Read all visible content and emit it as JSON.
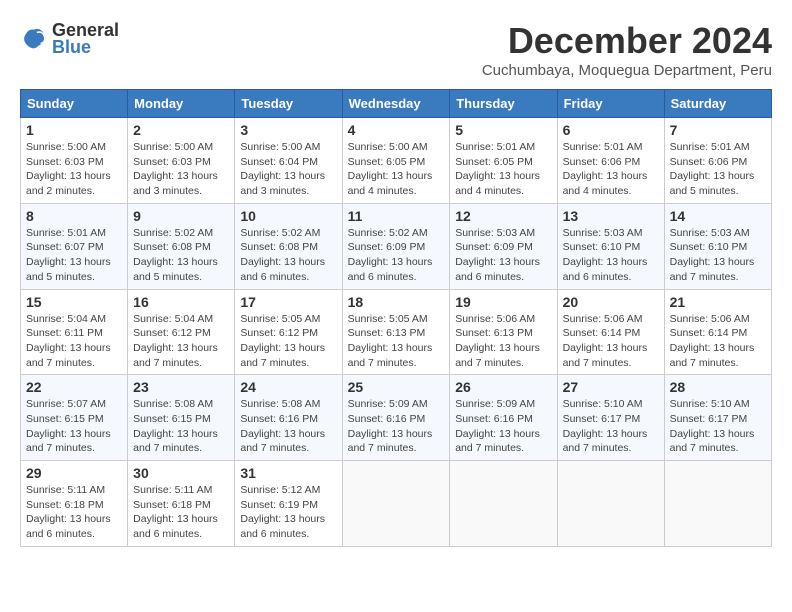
{
  "logo": {
    "general": "General",
    "blue": "Blue"
  },
  "title": "December 2024",
  "subtitle": "Cuchumbaya, Moquegua Department, Peru",
  "weekdays": [
    "Sunday",
    "Monday",
    "Tuesday",
    "Wednesday",
    "Thursday",
    "Friday",
    "Saturday"
  ],
  "weeks": [
    [
      {
        "day": "1",
        "sunrise": "5:00 AM",
        "sunset": "6:03 PM",
        "daylight": "13 hours and 2 minutes."
      },
      {
        "day": "2",
        "sunrise": "5:00 AM",
        "sunset": "6:03 PM",
        "daylight": "13 hours and 3 minutes."
      },
      {
        "day": "3",
        "sunrise": "5:00 AM",
        "sunset": "6:04 PM",
        "daylight": "13 hours and 3 minutes."
      },
      {
        "day": "4",
        "sunrise": "5:00 AM",
        "sunset": "6:05 PM",
        "daylight": "13 hours and 4 minutes."
      },
      {
        "day": "5",
        "sunrise": "5:01 AM",
        "sunset": "6:05 PM",
        "daylight": "13 hours and 4 minutes."
      },
      {
        "day": "6",
        "sunrise": "5:01 AM",
        "sunset": "6:06 PM",
        "daylight": "13 hours and 4 minutes."
      },
      {
        "day": "7",
        "sunrise": "5:01 AM",
        "sunset": "6:06 PM",
        "daylight": "13 hours and 5 minutes."
      }
    ],
    [
      {
        "day": "8",
        "sunrise": "5:01 AM",
        "sunset": "6:07 PM",
        "daylight": "13 hours and 5 minutes."
      },
      {
        "day": "9",
        "sunrise": "5:02 AM",
        "sunset": "6:08 PM",
        "daylight": "13 hours and 5 minutes."
      },
      {
        "day": "10",
        "sunrise": "5:02 AM",
        "sunset": "6:08 PM",
        "daylight": "13 hours and 6 minutes."
      },
      {
        "day": "11",
        "sunrise": "5:02 AM",
        "sunset": "6:09 PM",
        "daylight": "13 hours and 6 minutes."
      },
      {
        "day": "12",
        "sunrise": "5:03 AM",
        "sunset": "6:09 PM",
        "daylight": "13 hours and 6 minutes."
      },
      {
        "day": "13",
        "sunrise": "5:03 AM",
        "sunset": "6:10 PM",
        "daylight": "13 hours and 6 minutes."
      },
      {
        "day": "14",
        "sunrise": "5:03 AM",
        "sunset": "6:10 PM",
        "daylight": "13 hours and 7 minutes."
      }
    ],
    [
      {
        "day": "15",
        "sunrise": "5:04 AM",
        "sunset": "6:11 PM",
        "daylight": "13 hours and 7 minutes."
      },
      {
        "day": "16",
        "sunrise": "5:04 AM",
        "sunset": "6:12 PM",
        "daylight": "13 hours and 7 minutes."
      },
      {
        "day": "17",
        "sunrise": "5:05 AM",
        "sunset": "6:12 PM",
        "daylight": "13 hours and 7 minutes."
      },
      {
        "day": "18",
        "sunrise": "5:05 AM",
        "sunset": "6:13 PM",
        "daylight": "13 hours and 7 minutes."
      },
      {
        "day": "19",
        "sunrise": "5:06 AM",
        "sunset": "6:13 PM",
        "daylight": "13 hours and 7 minutes."
      },
      {
        "day": "20",
        "sunrise": "5:06 AM",
        "sunset": "6:14 PM",
        "daylight": "13 hours and 7 minutes."
      },
      {
        "day": "21",
        "sunrise": "5:06 AM",
        "sunset": "6:14 PM",
        "daylight": "13 hours and 7 minutes."
      }
    ],
    [
      {
        "day": "22",
        "sunrise": "5:07 AM",
        "sunset": "6:15 PM",
        "daylight": "13 hours and 7 minutes."
      },
      {
        "day": "23",
        "sunrise": "5:08 AM",
        "sunset": "6:15 PM",
        "daylight": "13 hours and 7 minutes."
      },
      {
        "day": "24",
        "sunrise": "5:08 AM",
        "sunset": "6:16 PM",
        "daylight": "13 hours and 7 minutes."
      },
      {
        "day": "25",
        "sunrise": "5:09 AM",
        "sunset": "6:16 PM",
        "daylight": "13 hours and 7 minutes."
      },
      {
        "day": "26",
        "sunrise": "5:09 AM",
        "sunset": "6:16 PM",
        "daylight": "13 hours and 7 minutes."
      },
      {
        "day": "27",
        "sunrise": "5:10 AM",
        "sunset": "6:17 PM",
        "daylight": "13 hours and 7 minutes."
      },
      {
        "day": "28",
        "sunrise": "5:10 AM",
        "sunset": "6:17 PM",
        "daylight": "13 hours and 7 minutes."
      }
    ],
    [
      {
        "day": "29",
        "sunrise": "5:11 AM",
        "sunset": "6:18 PM",
        "daylight": "13 hours and 6 minutes."
      },
      {
        "day": "30",
        "sunrise": "5:11 AM",
        "sunset": "6:18 PM",
        "daylight": "13 hours and 6 minutes."
      },
      {
        "day": "31",
        "sunrise": "5:12 AM",
        "sunset": "6:19 PM",
        "daylight": "13 hours and 6 minutes."
      },
      null,
      null,
      null,
      null
    ]
  ]
}
